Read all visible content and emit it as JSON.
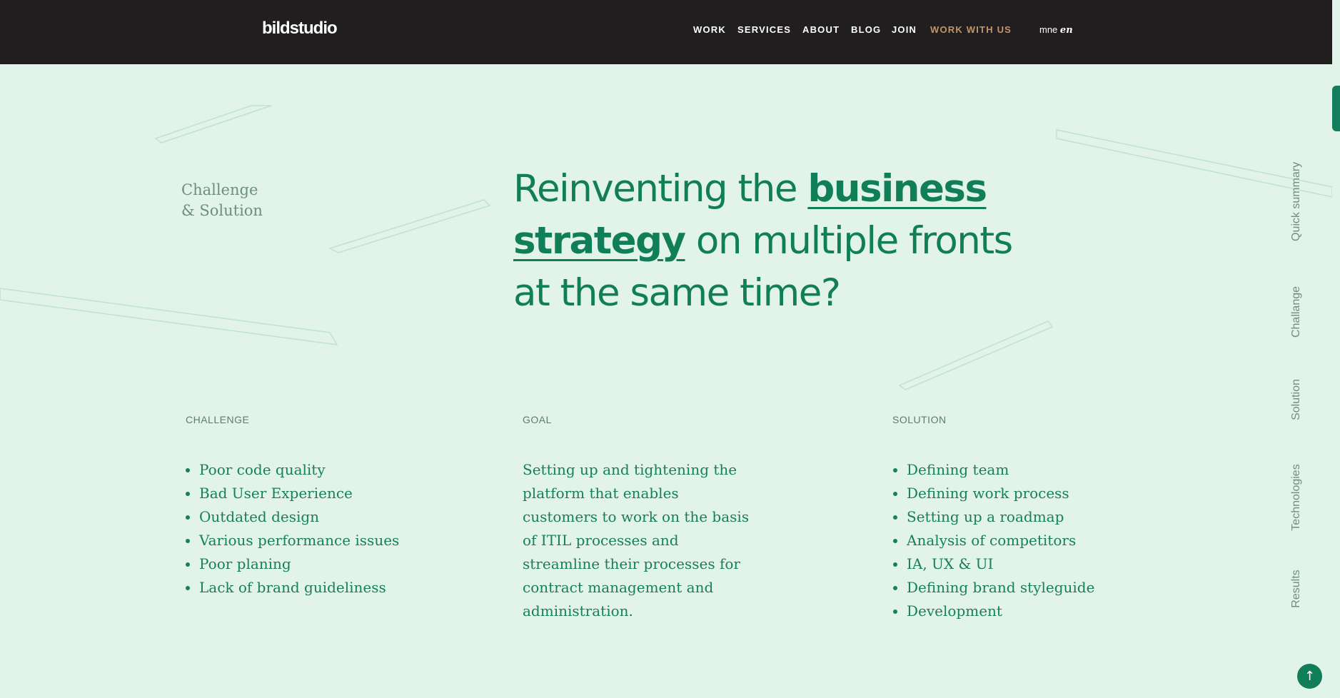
{
  "header": {
    "logo": "bildstudio",
    "nav": [
      {
        "label": "WORK"
      },
      {
        "label": "SERVICES"
      },
      {
        "label": "ABOUT"
      },
      {
        "label": "BLOG"
      },
      {
        "label": "JOIN"
      },
      {
        "label": "WORK WITH US",
        "accent": true
      }
    ],
    "lang": {
      "inactive": "mne",
      "active": "en"
    }
  },
  "section": {
    "label_line1": "Challenge",
    "label_line2": "& Solution",
    "headline": {
      "part1": "Reinventing the ",
      "bold1": "business",
      "bold2": "strategy",
      "part2": " on multiple fronts",
      "part3": "at the same time?"
    }
  },
  "columns": {
    "challenge": {
      "heading": "CHALLENGE",
      "items": [
        "Poor code quality",
        "Bad User Experience",
        "Outdated design",
        "Various performance issues",
        "Poor planing",
        "Lack of brand guideliness"
      ]
    },
    "goal": {
      "heading": "GOAL",
      "text": "Setting up and tightening the platform that enables customers to work on the basis of ITIL processes and streamline their processes for contract management and administration."
    },
    "solution": {
      "heading": "SOLUTION",
      "items": [
        "Defining team",
        "Defining work process",
        "Setting up a roadmap",
        "Analysis of competitors",
        "IA, UX & UI",
        "Defining brand styleguide",
        "Development"
      ]
    }
  },
  "side_nav": [
    "Quick summary",
    "Challange",
    "Solution",
    "Technologies",
    "Results"
  ],
  "back_to_top_icon": "arrow-up-icon",
  "colors": {
    "background": "#e2f3e9",
    "header": "#211e1f",
    "accent_green": "#117e5a",
    "accent_orange": "#c59569"
  }
}
